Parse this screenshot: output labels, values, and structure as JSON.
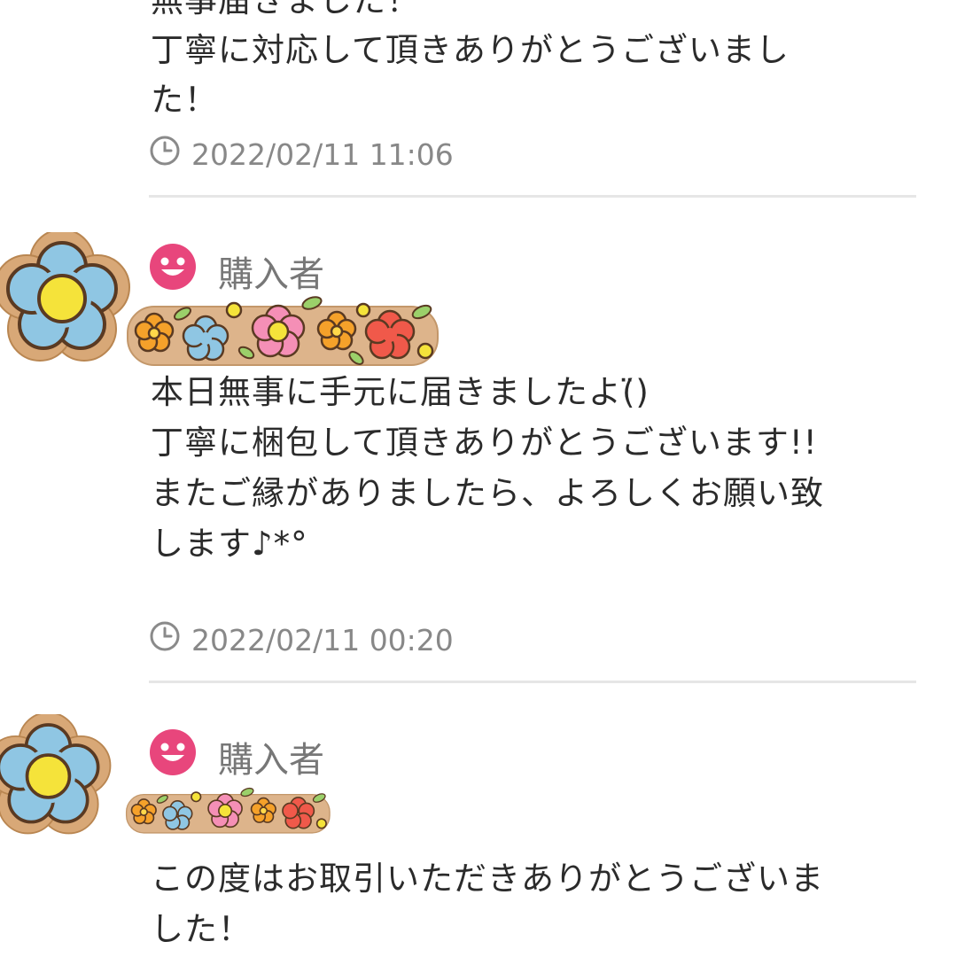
{
  "reviews": [
    {
      "message": [
        "無事届きました！",
        "丁寧に対応して頂きありがとうございまし",
        "た！"
      ],
      "timestamp": "2022/02/11 11:06"
    },
    {
      "role": "購入者",
      "message": [
        "本日無事に手元に届きましたよ(︎̈)",
        "丁寧に梱包して頂きありがとうございます!!",
        "またご縁がありましたら、よろしくお願い致",
        "します♪*°"
      ],
      "timestamp": "2022/02/11 00:20"
    },
    {
      "role": "購入者",
      "message": [
        "この度はお取引いただきありがとうございま",
        "した！"
      ]
    }
  ],
  "icons": {
    "clock": "clock-icon",
    "buyer": "smiley-face-icon",
    "avatar": "flower-avatar",
    "name_decoration": "flower-sticker-decoration"
  },
  "colors": {
    "buyer_icon": "#e8467c",
    "timestamp": "#888888",
    "divider": "#e6e6e6",
    "flower_blue": "#8fc6e3",
    "flower_yellow": "#f5e33a",
    "flower_wood": "#d8a877"
  }
}
